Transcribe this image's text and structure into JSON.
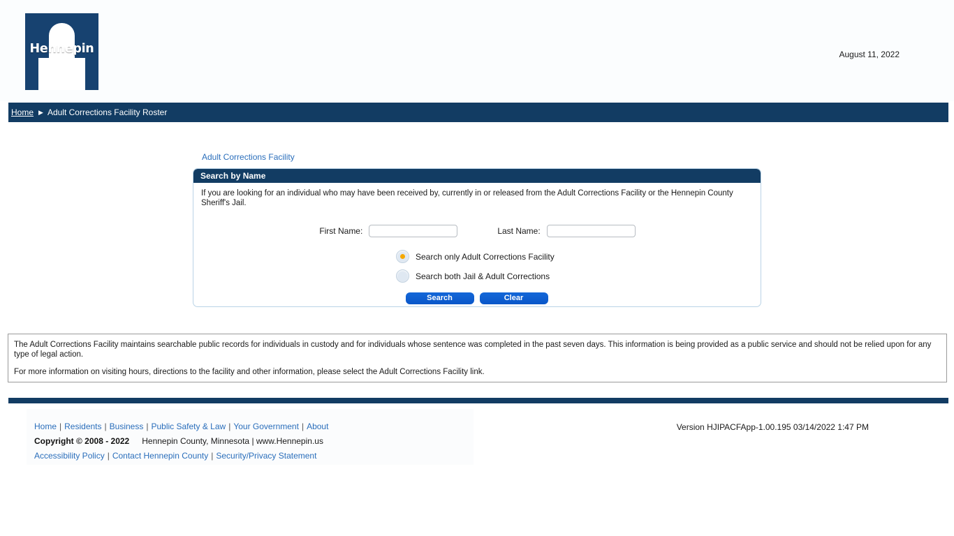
{
  "header": {
    "logo_text": "Hennepin",
    "logo_color": "#174270",
    "date": "August 11, 2022"
  },
  "breadcrumb": {
    "home_label": "Home",
    "separator": "▶",
    "current_label": "Adult Corrections Facility Roster"
  },
  "facility_link": {
    "label": "Adult Corrections Facility"
  },
  "search_panel": {
    "title": "Search by Name",
    "description": "If you are looking for an individual who may have been received by, currently in or released from the Adult Corrections Facility or the Hennepin County Sheriff's Jail.",
    "first_name_label": "First Name:",
    "first_name_value": "",
    "first_name_placeholder": "",
    "last_name_label": "Last Name:",
    "last_name_value": "",
    "last_name_placeholder": "",
    "radio_options": [
      {
        "label": "Search only Adult Corrections Facility",
        "selected": true
      },
      {
        "label": "Search both Jail & Adult Corrections",
        "selected": false
      }
    ],
    "search_button": "Search",
    "clear_button": "Clear",
    "accent_color": "#0b5ed7",
    "radio_dot_color": "#f5a800"
  },
  "info_box": {
    "paragraph_1": "The Adult Corrections Facility maintains searchable public records for individuals in custody and for individuals whose sentence was completed in the past seven days. This information is being provided as a public service and should not be relied upon for any type of legal action.",
    "paragraph_2": "For more information on visiting hours, directions to the facility and other information, please select the Adult Corrections Facility link."
  },
  "footer": {
    "nav_links": [
      "Home",
      "Residents",
      "Business",
      "Public Safety & Law",
      "Your Government",
      "About"
    ],
    "separator": "|",
    "copyright_bold": "Copyright © 2008 - 2022",
    "copyright_plain": "Hennepin County, Minnesota | www.Hennepin.us",
    "policy_links": [
      "Accessibility Policy",
      "Contact Hennepin County",
      "Security/Privacy Statement"
    ],
    "version": "Version HJIPACFApp-1.00.195 03/14/2022 1:47 PM",
    "bar_color": "#123c63"
  }
}
